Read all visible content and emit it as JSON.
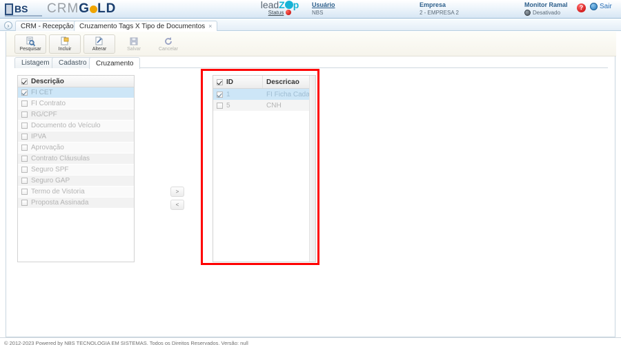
{
  "header": {
    "logo_text_crm": "CRM",
    "logo_text_g": "G",
    "logo_text_old": "LD",
    "logo_mark": "NBS",
    "leadzap": {
      "lead": "lead",
      "z": "Z",
      "ap": "p",
      "status_label": "Status"
    },
    "usuario": {
      "label": "Usuário",
      "value": "NBS"
    },
    "empresa": {
      "label": "Empresa",
      "value": "2 - EMPRESA 2"
    },
    "monitor": {
      "label": "Monitor Ramal",
      "value": "Desativado"
    },
    "help_glyph": "?",
    "logout_label": "Sair"
  },
  "page_tabs": {
    "nav_arrow": "›",
    "close_glyph": "×",
    "items": [
      {
        "label": "CRM - Recepção",
        "active": false
      },
      {
        "label": "Cruzamento Tags X Tipo de Documentos",
        "active": true
      }
    ]
  },
  "toolbar": {
    "buttons": [
      {
        "label": "Pesquisar",
        "icon": "search-page-icon",
        "disabled": false
      },
      {
        "label": "Incluir",
        "icon": "new-page-icon",
        "disabled": false
      },
      {
        "label": "Alterar",
        "icon": "edit-page-icon",
        "disabled": false
      },
      {
        "label": "Salvar",
        "icon": "floppy-disk-icon",
        "disabled": true
      },
      {
        "label": "Cancelar",
        "icon": "undo-refresh-icon",
        "disabled": true
      }
    ]
  },
  "subtabs": [
    {
      "label": "Listagem",
      "active": false
    },
    {
      "label": "Cadastro",
      "active": false
    },
    {
      "label": "Cruzamento",
      "active": true
    }
  ],
  "left_list": {
    "header_label": "Descrição",
    "header_checked": true,
    "rows": [
      {
        "label": "FI CET",
        "checked": true,
        "selected": true
      },
      {
        "label": "FI Contrato",
        "checked": false,
        "selected": false
      },
      {
        "label": "RG/CPF",
        "checked": false,
        "selected": false
      },
      {
        "label": "Documento do Veículo",
        "checked": false,
        "selected": false
      },
      {
        "label": "IPVA",
        "checked": false,
        "selected": false
      },
      {
        "label": "Aprovação",
        "checked": false,
        "selected": false
      },
      {
        "label": "Contrato Cláusulas",
        "checked": false,
        "selected": false
      },
      {
        "label": "Seguro SPF",
        "checked": false,
        "selected": false
      },
      {
        "label": "Seguro GAP",
        "checked": false,
        "selected": false
      },
      {
        "label": "Termo de Vistoria",
        "checked": false,
        "selected": false
      },
      {
        "label": "Proposta Assinada",
        "checked": false,
        "selected": false
      }
    ]
  },
  "transfer": {
    "move_right_label": ">",
    "move_left_label": "<"
  },
  "right_grid": {
    "columns": [
      {
        "label": "ID",
        "checked": true
      },
      {
        "label": "Descricao"
      }
    ],
    "rows": [
      {
        "id": "1",
        "descricao": "FI Ficha Cadastral",
        "checked": true,
        "selected": true
      },
      {
        "id": "5",
        "descricao": "CNH",
        "checked": false,
        "selected": false
      }
    ]
  },
  "annotation": {
    "color": "#ff0000"
  },
  "footer": {
    "text": "© 2012-2023 Powered by NBS TECNOLOGIA EM SISTEMAS. Todos os Direitos Reservados.   Versão: null"
  }
}
